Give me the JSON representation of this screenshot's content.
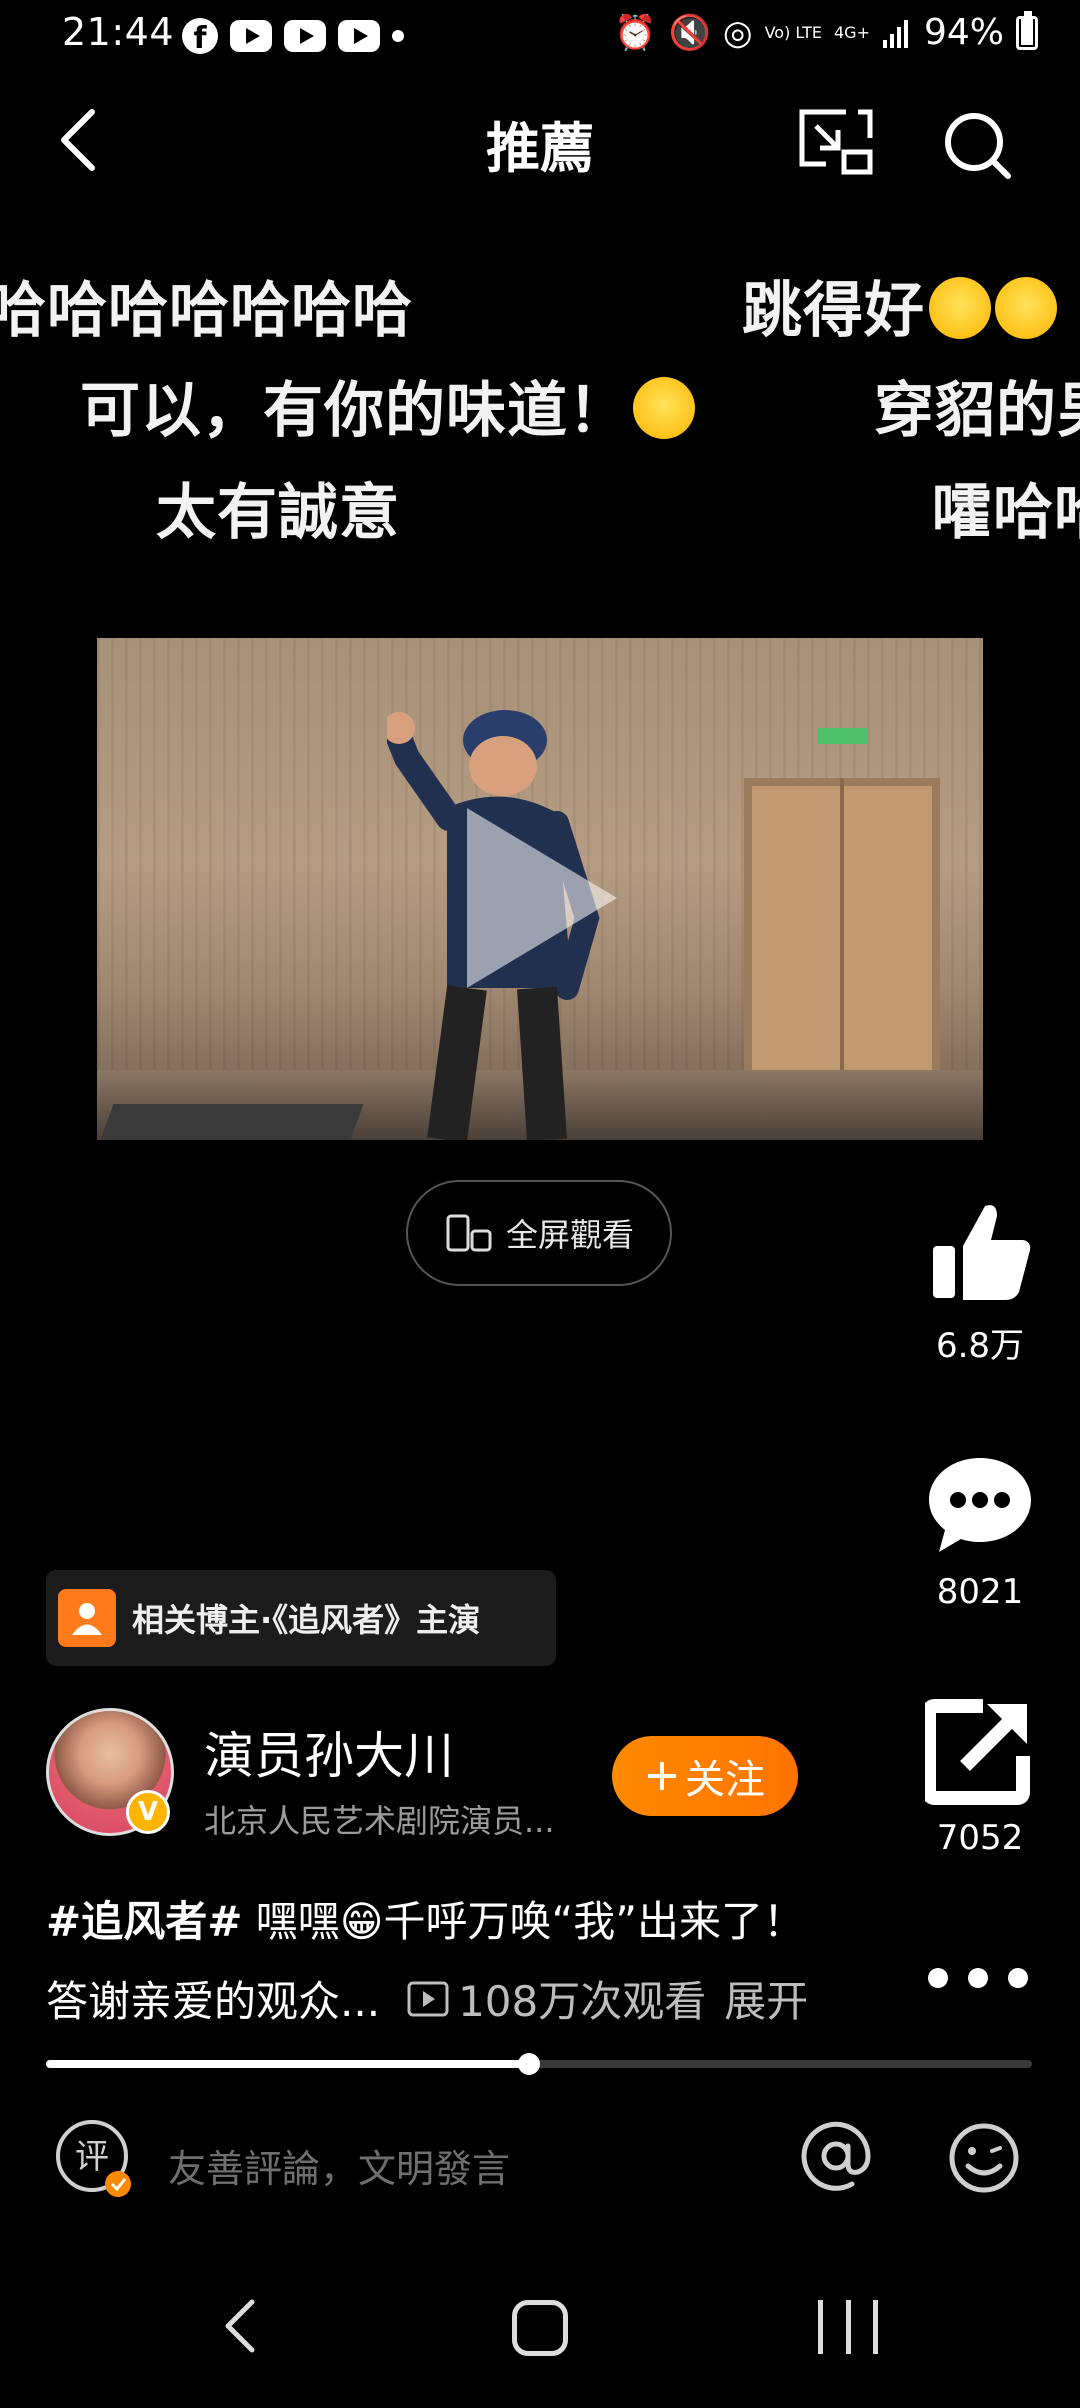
{
  "status_bar": {
    "time": "21:44",
    "lte_label": "Vo) LTE",
    "network": "4G+",
    "battery": "94%",
    "battery_level": 0.94
  },
  "header": {
    "title": "推薦"
  },
  "danmaku": [
    {
      "text": "哈哈哈哈哈哈哈",
      "emoji": false
    },
    {
      "text": "跳得好",
      "emoji": true
    },
    {
      "text": "可以，有你的味道！",
      "emoji": true
    },
    {
      "text": "穿貂的男",
      "emoji": false
    },
    {
      "text": "太有誠意",
      "emoji": false
    },
    {
      "text": "嚯哈哈",
      "emoji": false
    }
  ],
  "fullscreen_label": "全屏觀看",
  "actions": {
    "likes": "6.8万",
    "comments": "8021",
    "shares": "7052"
  },
  "related": {
    "label": "相关博主·《追风者》主演"
  },
  "author": {
    "name": "演员孙大川",
    "desc": "北京人民艺术剧院演员...",
    "verified_mark": "V",
    "follow_label": "关注"
  },
  "caption": {
    "hashtag": "#追风者#",
    "line1": " 嘿嘿😁千呼万唤“我”出来了！",
    "line2": "答谢亲爱的观众...",
    "views": "108万次观看",
    "expand": "展开"
  },
  "progress": {
    "value": 0.49
  },
  "comment_bar": {
    "placeholder": "友善評論，文明發言",
    "icon_char": "评"
  },
  "colors": {
    "accent": "#ff7a00",
    "background": "#000000"
  }
}
